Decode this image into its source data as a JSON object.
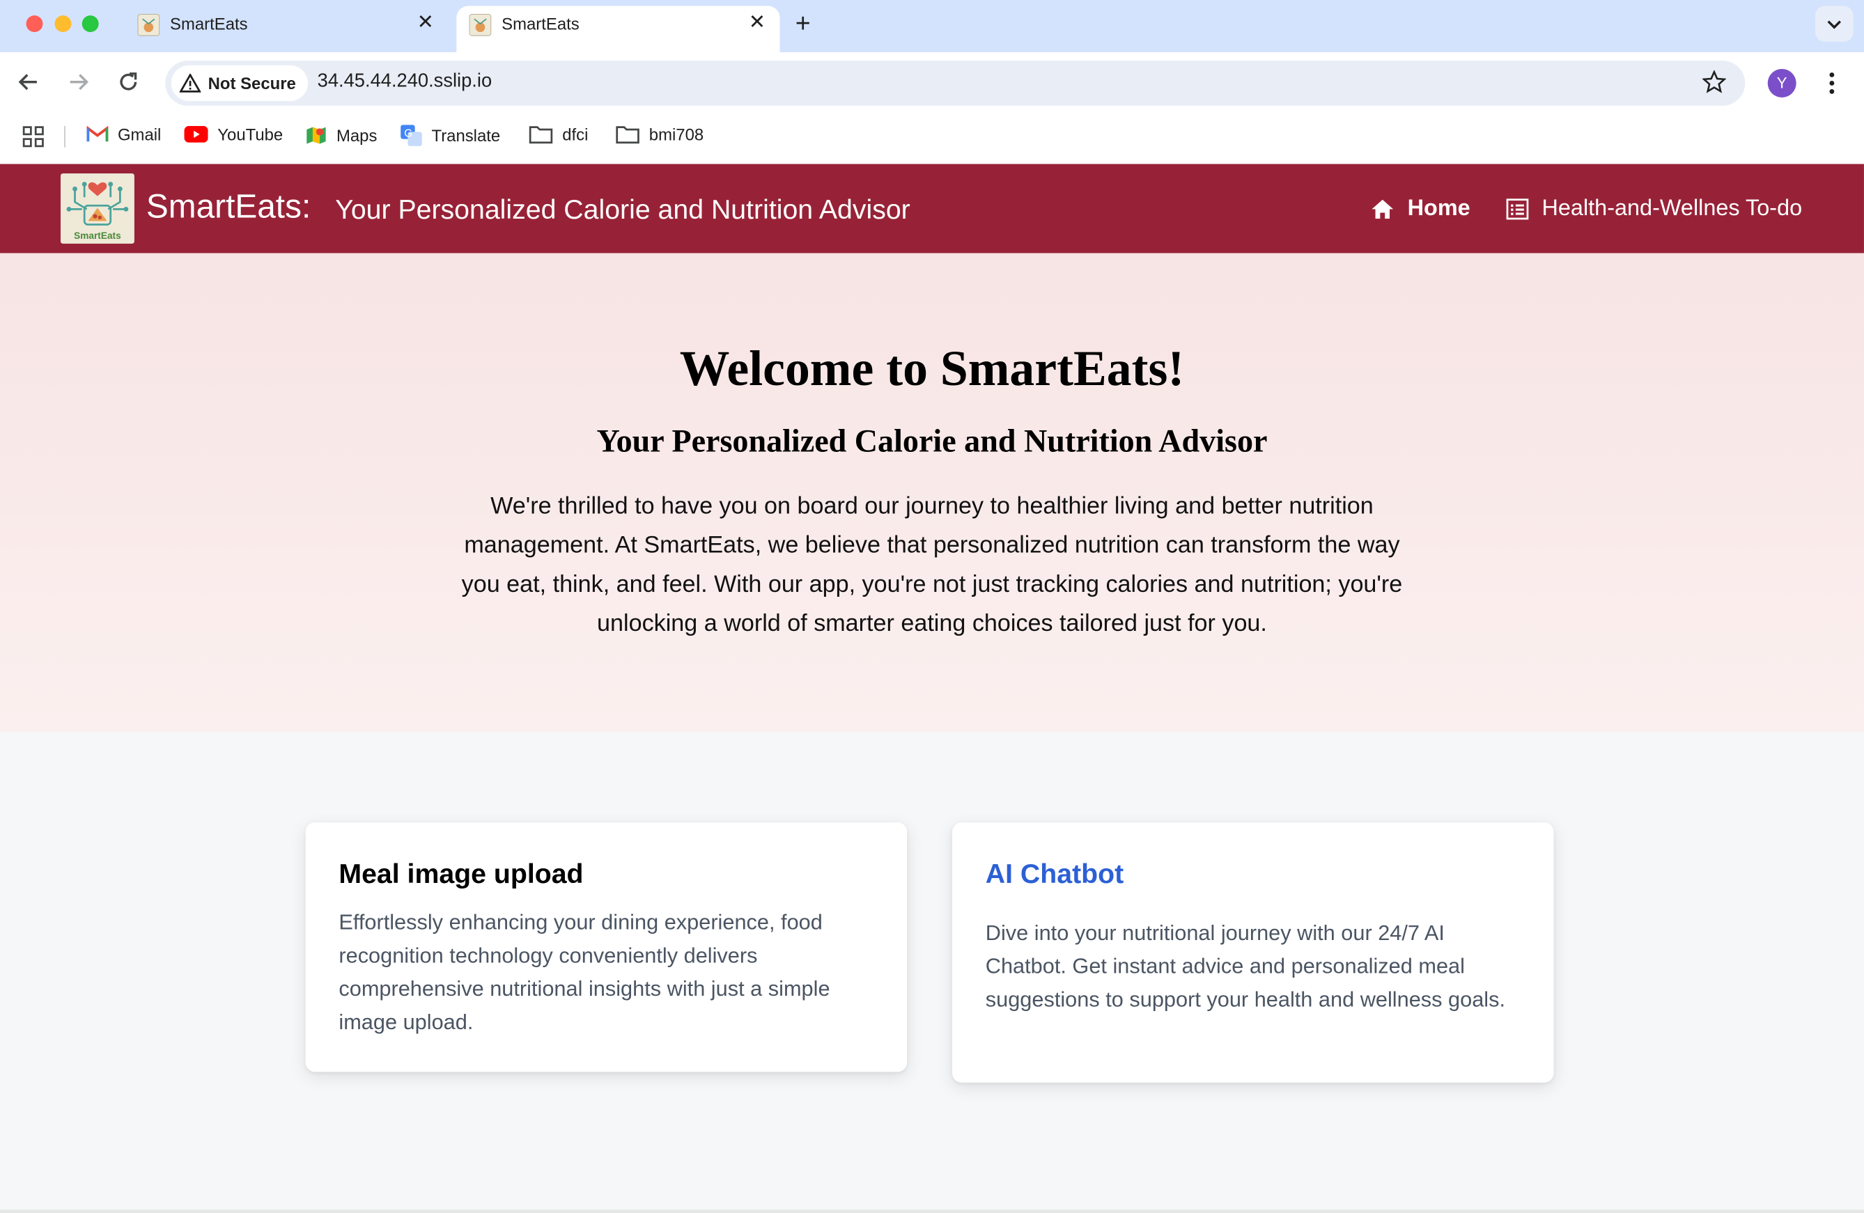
{
  "browser": {
    "tabs": [
      {
        "title": "SmartEats",
        "active": false
      },
      {
        "title": "SmartEats",
        "active": true
      }
    ],
    "security_chip": "Not Secure",
    "url": "34.45.44.240.sslip.io",
    "avatar_letter": "Y",
    "bookmarks": [
      {
        "label": "Gmail",
        "icon": "gmail-icon"
      },
      {
        "label": "YouTube",
        "icon": "youtube-icon"
      },
      {
        "label": "Maps",
        "icon": "maps-icon"
      },
      {
        "label": "Translate",
        "icon": "translate-icon"
      },
      {
        "label": "dfci",
        "icon": "folder-icon"
      },
      {
        "label": "bmi708",
        "icon": "folder-icon"
      }
    ]
  },
  "navbar": {
    "brand": "SmartEats:",
    "tagline": "Your Personalized Calorie and Nutrition Advisor",
    "links": [
      {
        "label": "Home",
        "icon": "home-icon",
        "active": true
      },
      {
        "label": "Health-and-Wellnes To-do",
        "icon": "list-icon",
        "active": false
      }
    ],
    "logo_text": "SmartEats"
  },
  "hero": {
    "title": "Welcome to SmartEats!",
    "subtitle": "Your Personalized Calorie and Nutrition Advisor",
    "body": "We're thrilled to have you on board our journey to healthier living and better nutrition management. At SmartEats, we believe that personalized nutrition can transform the way you eat, think, and feel. With our app, you're not just tracking calories and nutrition; you're unlocking a world of smarter eating choices tailored just for you."
  },
  "features": [
    {
      "title": "Meal image upload",
      "description": "Effortlessly enhancing your dining experience, food recognition technology conveniently delivers comprehensive nutritional insights with just a simple image upload."
    },
    {
      "title": "AI Chatbot",
      "description": "Dive into your nutritional journey with our 24/7 AI Chatbot. Get instant advice and personalized meal suggestions to support your health and wellness goals."
    }
  ],
  "colors": {
    "navbar": "#972237",
    "link_accent": "#2c60d4",
    "tabstrip": "#d3e3fd"
  }
}
